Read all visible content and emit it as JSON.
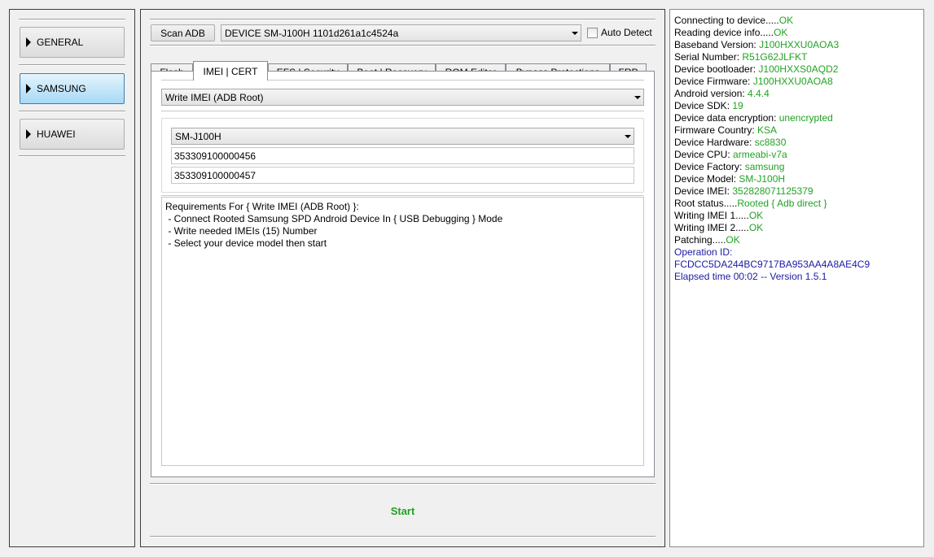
{
  "sidebar": {
    "items": [
      {
        "label": "GENERAL",
        "active": false
      },
      {
        "label": "SAMSUNG",
        "active": true
      },
      {
        "label": "HUAWEI",
        "active": false
      }
    ]
  },
  "toolbar": {
    "scan_label": "Scan ADB",
    "device_value": "DEVICE SM-J100H 1101d261a1c4524a",
    "auto_detect_label": "Auto Detect"
  },
  "tabs": [
    {
      "label": "Flash"
    },
    {
      "label": "IMEI | CERT",
      "active": true
    },
    {
      "label": "EFS | Security"
    },
    {
      "label": "Boot | Recovery"
    },
    {
      "label": "ROM Editor"
    },
    {
      "label": "Bypass Protections"
    },
    {
      "label": "FRP"
    }
  ],
  "imei_tab": {
    "operation_value": "Write IMEI (ADB Root)",
    "model_value": "SM-J100H",
    "imei1_value": "353309100000456",
    "imei2_value": "353309100000457",
    "requirements": [
      "Requirements For { Write IMEI (ADB Root) }:",
      " - Connect Rooted Samsung SPD Android Device In { USB Debugging } Mode",
      " - Write needed IMEIs (15) Number",
      " - Select your device model then start"
    ]
  },
  "start_label": "Start",
  "colors": {
    "ok": "#22a222",
    "blue": "#1a1aa6",
    "active_tab_button": "#a7d9f5"
  },
  "log": [
    {
      "label": "Connecting to device.....",
      "value": "OK",
      "style": "ok"
    },
    {
      "label": "Reading device info.....",
      "value": "OK",
      "style": "ok"
    },
    {
      "label": "Baseband Version: ",
      "value": "J100HXXU0AOA3",
      "style": "ok"
    },
    {
      "label": "Serial Number: ",
      "value": "R51G62JLFKT",
      "style": "ok"
    },
    {
      "label": "Device bootloader: ",
      "value": "J100HXXS0AQD2",
      "style": "ok"
    },
    {
      "label": "Device Firmware: ",
      "value": "J100HXXU0AOA8",
      "style": "ok"
    },
    {
      "label": "Android version: ",
      "value": "4.4.4",
      "style": "ok"
    },
    {
      "label": "Device SDK: ",
      "value": "19",
      "style": "ok"
    },
    {
      "label": "Device data encryption: ",
      "value": "unencrypted",
      "style": "ok"
    },
    {
      "label": "Firmware Country: ",
      "value": "KSA",
      "style": "ok"
    },
    {
      "label": "Device Hardware: ",
      "value": "sc8830",
      "style": "ok"
    },
    {
      "label": "Device CPU: ",
      "value": "armeabi-v7a",
      "style": "ok"
    },
    {
      "label": "Device Factory: ",
      "value": "samsung",
      "style": "ok"
    },
    {
      "label": "Device Model: ",
      "value": "SM-J100H",
      "style": "ok"
    },
    {
      "label": "Device IMEI: ",
      "value": "352828071125379",
      "style": "ok"
    },
    {
      "label": "Root status.....",
      "value": "Rooted { Adb direct }",
      "style": "ok"
    },
    {
      "label": "Writing IMEI 1.....",
      "value": "OK",
      "style": "ok"
    },
    {
      "label": "Writing IMEI 2.....",
      "value": "OK",
      "style": "ok"
    },
    {
      "label": "Patching.....",
      "value": "OK",
      "style": "ok"
    },
    {
      "label": "",
      "value": "Operation ID:",
      "style": "blue"
    },
    {
      "label": "",
      "value": "FCDCC5DA244BC9717BA953AA4A8AE4C9",
      "style": "blue"
    },
    {
      "label": "",
      "value": "Elapsed time 00:02 -- Version 1.5.1",
      "style": "blue"
    }
  ]
}
